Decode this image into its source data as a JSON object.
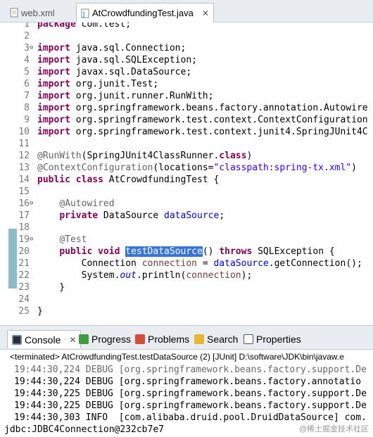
{
  "tabs": [
    {
      "label": "web.xml",
      "active": false
    },
    {
      "label": "AtCrowdfundingTest.java",
      "active": true,
      "close": "✕"
    }
  ],
  "editor": {
    "lines": [
      {
        "n": "1",
        "html": "<span class=\"kw\">package</span> com.test;"
      },
      {
        "n": "2",
        "html": ""
      },
      {
        "n": "3",
        "fold": "⊖",
        "html": "<span class=\"kw\">import</span> java.sql.Connection;"
      },
      {
        "n": "4",
        "html": "<span class=\"kw\">import</span> java.sql.SQLException;"
      },
      {
        "n": "5",
        "html": "<span class=\"kw\">import</span> javax.sql.DataSource;"
      },
      {
        "n": "6",
        "html": "<span class=\"kw\">import</span> org.junit.Test;"
      },
      {
        "n": "7",
        "html": "<span class=\"kw\">import</span> org.junit.runner.RunWith;"
      },
      {
        "n": "8",
        "html": "<span class=\"kw\">import</span> org.springframework.beans.factory.annotation.Autowire"
      },
      {
        "n": "9",
        "html": "<span class=\"kw\">import</span> org.springframework.test.context.ContextConfiguration"
      },
      {
        "n": "10",
        "html": "<span class=\"kw\">import</span> org.springframework.test.context.junit4.SpringJUnit4C"
      },
      {
        "n": "11",
        "html": ""
      },
      {
        "n": "12",
        "html": "<span class=\"ann\">@RunWith</span>(SpringJUnit4ClassRunner.<span class=\"kw\">class</span>)"
      },
      {
        "n": "13",
        "html": "<span class=\"ann\">@ContextConfiguration</span>(locations=<span class=\"str\">\"classpath:spring-tx.xml\"</span>)"
      },
      {
        "n": "14",
        "html": "<span class=\"kw\">public</span> <span class=\"kw\">class</span> AtCrowdfundingTest {"
      },
      {
        "n": "15",
        "html": ""
      },
      {
        "n": "16",
        "fold": "⊖",
        "html": "    <span class=\"ann\">@Autowired</span>"
      },
      {
        "n": "17",
        "html": "    <span class=\"kw\">private</span> DataSource <span class=\"fld\">dataSource</span>;"
      },
      {
        "n": "18",
        "html": ""
      },
      {
        "n": "19",
        "fold": "⊖",
        "html": "    <span class=\"ann\">@Test</span>"
      },
      {
        "n": "20",
        "html": "    <span class=\"kw\">public</span> <span class=\"kw\">void</span> <span class=\"sel\">testDataSource</span>() <span class=\"kw\">throws</span> SQLException {"
      },
      {
        "n": "21",
        "html": "        Connection <span class=\"fld\" style=\"color:#6a3e3e\">connection</span> = <span class=\"fld\">dataSource</span>.getConnection();"
      },
      {
        "n": "22",
        "html": "        System.<span class=\"sfld\">out</span>.println(<span class=\"fld\" style=\"color:#6a3e3e\">connection</span>);"
      },
      {
        "n": "23",
        "html": "    }"
      },
      {
        "n": "24",
        "html": ""
      },
      {
        "n": "25",
        "html": "}"
      }
    ]
  },
  "console": {
    "tabs": [
      {
        "label": "Console",
        "icon": "console-icon",
        "active": true,
        "close": "✕"
      },
      {
        "label": "Progress",
        "icon": "progress-icon"
      },
      {
        "label": "Problems",
        "icon": "problems-icon"
      },
      {
        "label": "Search",
        "icon": "search-icon"
      },
      {
        "label": "Properties",
        "icon": "properties-icon"
      }
    ],
    "status": "<terminated> AtCrowdfundingTest.testDataSource (2) [JUnit] D:\\software\\JDK\\bin\\javaw.e",
    "lines": [
      "19:44:30,224 DEBUG [org.springframework.beans.factory.support.De",
      "19:44:30,224 DEBUG [org.springframework.beans.factory.annotatio",
      "19:44:30,225 DEBUG [org.springframework.beans.factory.support.De",
      "19:44:30,225 DEBUG [org.springframework.beans.factory.support.De",
      "19:44:30,303 INFO  [com.alibaba.druid.pool.DruidDataSource] com.",
      "jdbc:JDBC4Connection@232cb7e7"
    ]
  },
  "watermark": "@稀土掘金技术社区"
}
